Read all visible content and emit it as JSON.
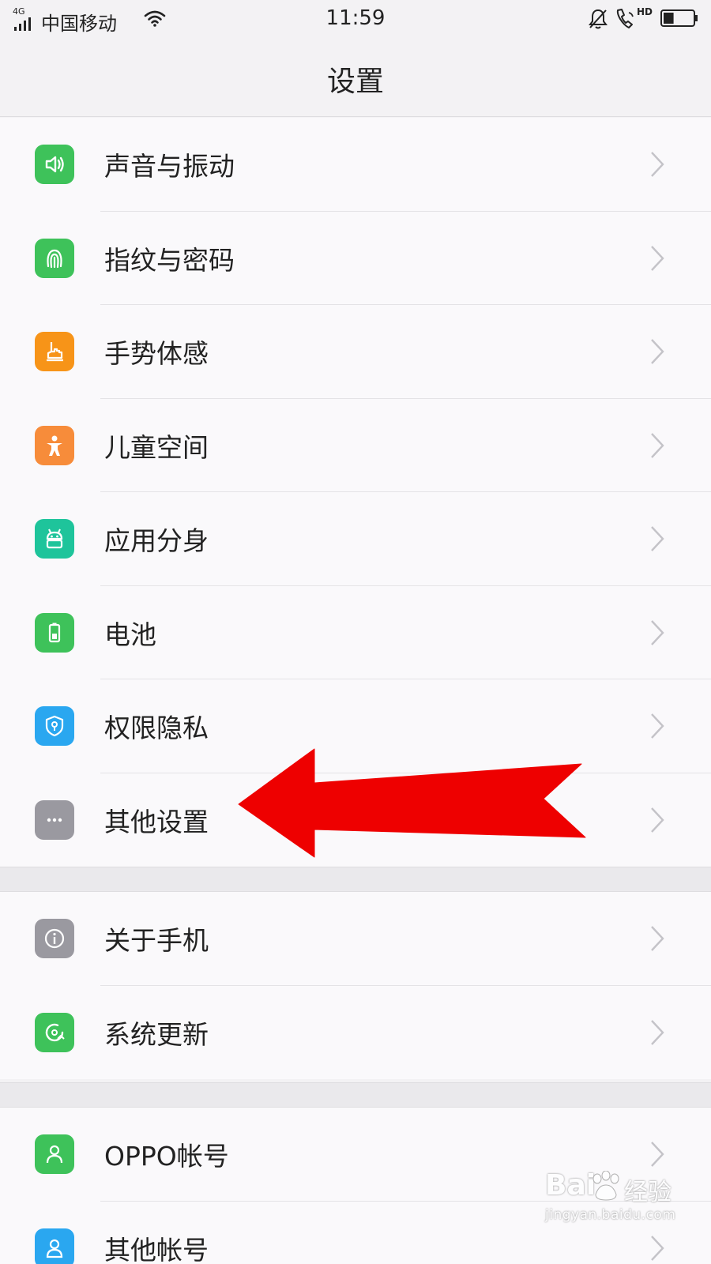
{
  "status_bar": {
    "network": "4G",
    "carrier": "中国移动",
    "time": "11:59",
    "hd_label": "HD",
    "battery_level": 0.35
  },
  "header": {
    "title": "设置"
  },
  "groups": [
    {
      "items": [
        {
          "label": "声音与振动",
          "icon": "speaker-icon",
          "color": "#3ec25a"
        },
        {
          "label": "指纹与密码",
          "icon": "fingerprint-icon",
          "color": "#3ec25a"
        },
        {
          "label": "手势体感",
          "icon": "hand-gesture-icon",
          "color": "#f79418"
        },
        {
          "label": "儿童空间",
          "icon": "child-icon",
          "color": "#f78c3a"
        },
        {
          "label": "应用分身",
          "icon": "app-clone-icon",
          "color": "#1ec49b"
        },
        {
          "label": "电池",
          "icon": "battery-icon",
          "color": "#3ec25a"
        },
        {
          "label": "权限隐私",
          "icon": "shield-icon",
          "color": "#2aa7f0"
        },
        {
          "label": "其他设置",
          "icon": "more-icon",
          "color": "#9a99a0"
        }
      ]
    },
    {
      "items": [
        {
          "label": "关于手机",
          "icon": "info-icon",
          "color": "#9a99a0"
        },
        {
          "label": "系统更新",
          "icon": "update-icon",
          "color": "#3ec25a"
        }
      ]
    },
    {
      "items": [
        {
          "label": "OPPO帐号",
          "icon": "account-icon",
          "color": "#3ec25a"
        },
        {
          "label": "其他帐号",
          "icon": "other-accounts-icon",
          "color": "#2aa7f0"
        }
      ]
    }
  ],
  "annotation": {
    "arrow_color": "#ee0000",
    "points_to": "其他设置"
  },
  "watermark": {
    "brand": "Bai",
    "suffix": "经验",
    "url": "jingyan.baidu.com"
  }
}
